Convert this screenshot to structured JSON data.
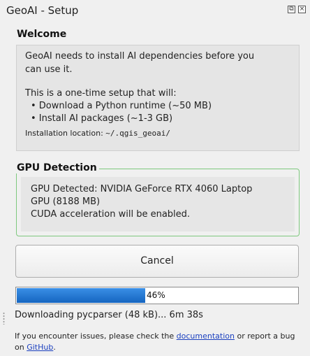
{
  "window": {
    "title": "GeoAI - Setup",
    "restore_glyph": "⧉",
    "close_glyph": "×"
  },
  "welcome": {
    "heading": "Welcome",
    "intro_line1": "GeoAI needs to install AI dependencies before you",
    "intro_line2": "can use it.",
    "setup_intro": "This is a one-time setup that will:",
    "bullet1": "• Download a Python runtime (~50 MB)",
    "bullet2": "• Install AI packages (~1-3 GB)",
    "location_label": "Installation location: ",
    "location_path": "~/.qgis_geoai/"
  },
  "gpu": {
    "heading": "GPU Detection",
    "line1": "GPU Detected: NVIDIA GeForce RTX 4060 Laptop",
    "line2": "GPU (8188 MB)",
    "line3": "CUDA acceleration will be enabled."
  },
  "actions": {
    "cancel_label": "Cancel"
  },
  "progress": {
    "value_percent": 46,
    "label": "46%"
  },
  "status": {
    "text": "Downloading pycparser (48 kB)... 6m 38s"
  },
  "help": {
    "prefix": "If you encounter issues, please check the ",
    "doc_link": "documentation",
    "middle": " or report a bug on ",
    "github_link": "GitHub",
    "suffix": "."
  },
  "colors": {
    "progress_fill": "#1e78dc",
    "gpu_border": "#7ec87e",
    "link": "#1a3fbf"
  }
}
